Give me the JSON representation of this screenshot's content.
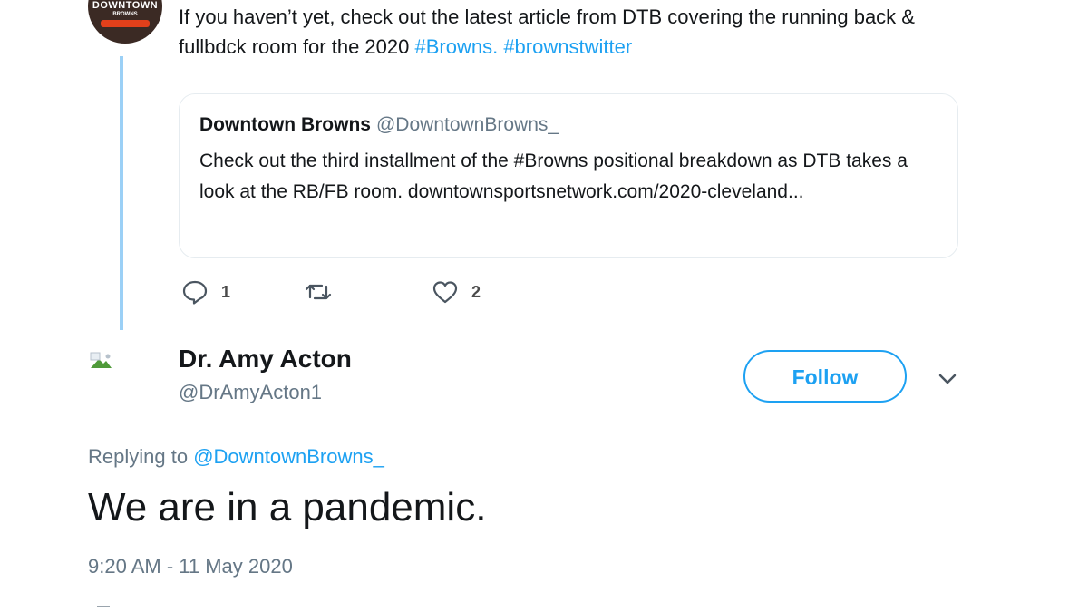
{
  "thread_tweet": {
    "avatar_logo_text": "DOWNTOWN",
    "avatar_logo_sub": "BROWNS",
    "text_prefix": "If you haven’t yet, check out the latest article from DTB covering the running back & fullbdck room for the 2020 ",
    "hashtag_1": "#Browns",
    "separator": ". ",
    "hashtag_2": "#brownstwitter"
  },
  "quoted_tweet": {
    "name": "Downtown Browns",
    "handle": "@DowntownBrowns_",
    "body": "Check out the third installment of the #Browns positional breakdown as DTB takes a look at the RB/FB room. downtownsportsnetwork.com/2020-cleveland..."
  },
  "actions": {
    "reply_icon": "reply-icon",
    "reply_count": "1",
    "retweet_icon": "retweet-icon",
    "like_icon": "heart-icon",
    "like_count": "2"
  },
  "reply_tweet": {
    "author_name": "Dr. Amy Acton",
    "author_handle": "@DrAmyActon1",
    "follow_label": "Follow",
    "menu_icon": "chevron-down-icon",
    "replying_label": "Replying to",
    "replying_to": "@DowntownBrowns_",
    "text": "We are in a pandemic.",
    "timestamp": "9:20 AM - 11 May 2020"
  },
  "colors": {
    "link": "#1da1f2",
    "thread_line": "#9bd0f6",
    "muted": "#657786"
  }
}
